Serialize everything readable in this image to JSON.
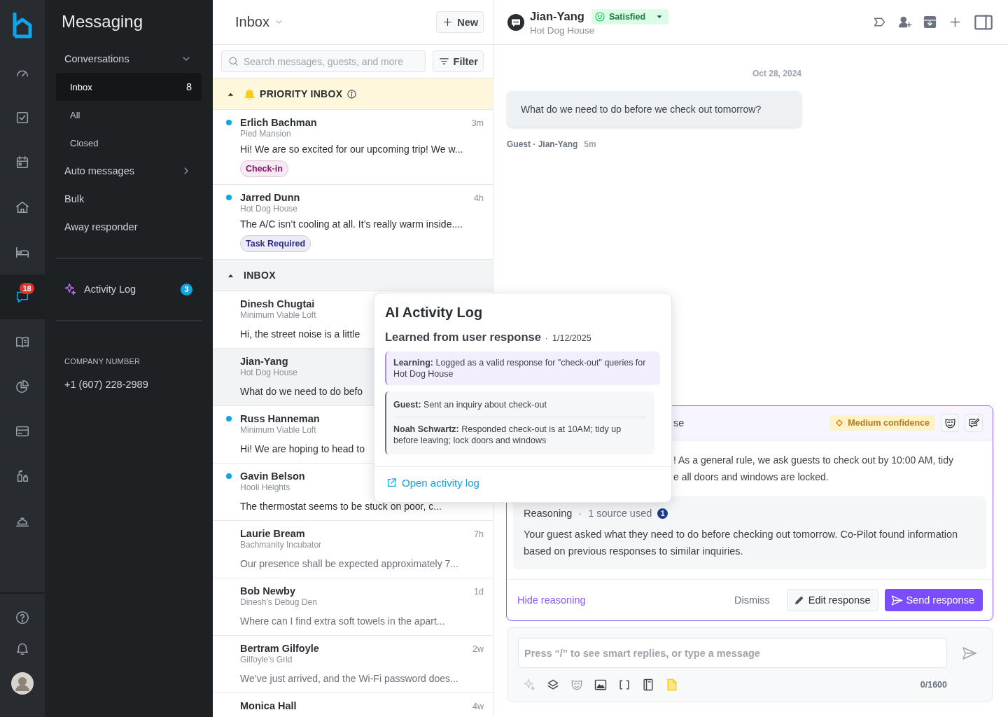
{
  "nav_rail": {
    "items": [
      {
        "selected": false
      },
      {
        "selected": false
      },
      {
        "selected": false
      },
      {
        "selected": false
      },
      {
        "selected": false
      },
      {
        "selected": true,
        "badge": "18"
      },
      {
        "selected": false
      },
      {
        "selected": false
      },
      {
        "selected": false
      },
      {
        "selected": false
      },
      {
        "selected": false
      }
    ]
  },
  "sidebar": {
    "title": "Messaging",
    "items": [
      {
        "kind": "group",
        "label": "Conversations",
        "expanded": true,
        "children": [
          {
            "label": "Inbox",
            "count": "8",
            "selected": true
          },
          {
            "label": "All",
            "selected": false
          },
          {
            "label": "Closed",
            "selected": false
          }
        ]
      },
      {
        "kind": "group",
        "label": "Auto messages",
        "expanded": false
      },
      {
        "kind": "link",
        "label": "Bulk"
      },
      {
        "kind": "link",
        "label": "Away responder"
      }
    ],
    "activity_log": {
      "label": "Activity Log",
      "badge": "3"
    },
    "company_number": {
      "label": "COMPANY NUMBER",
      "value": "+1 (607) 228-2989"
    }
  },
  "inbox": {
    "title": "Inbox",
    "new_button": "New",
    "search": {
      "placeholder": "Search messages, guests, and more"
    },
    "filter_button": "Filter",
    "sections": [
      {
        "kind": "priority",
        "title": "PRIORITY INBOX",
        "expanded": true,
        "rows": [
          {
            "name": "Erlich Bachman",
            "property": "Pied Mansion",
            "time": "3m",
            "preview": "Hi! We are so excited for our upcoming trip! We w...",
            "unread": true,
            "muted": false,
            "selected": false,
            "tag": {
              "label": "Check-in",
              "color": "#8a1466"
            }
          },
          {
            "name": "Jarred Dunn",
            "property": "Hot Dog House",
            "time": "4h",
            "preview": "The A/C isn’t cooling at all. It’s really warm inside....",
            "unread": true,
            "muted": false,
            "selected": false,
            "tag": {
              "label": "Task Required",
              "color": "#2e2a8c"
            }
          }
        ]
      },
      {
        "kind": "regular",
        "title": "INBOX",
        "expanded": true,
        "rows": [
          {
            "name": "Dinesh Chugtai",
            "property": "Minimum Viable Loft",
            "preview": "Hi, the street noise is a little",
            "unread": false,
            "muted": false,
            "selected": false
          },
          {
            "name": "Jian-Yang",
            "property": "Hot Dog House",
            "preview": "What do we need to do befo",
            "unread": false,
            "muted": false,
            "selected": true
          },
          {
            "name": "Russ Hanneman",
            "property": "Minimum Viable Loft",
            "preview": "Hi! We are hoping to head to",
            "unread": true,
            "muted": false,
            "selected": false
          },
          {
            "name": "Gavin Belson",
            "property": "Hooli Heights",
            "preview": "The thermostat seems to be stuck on poor, c...",
            "unread": true,
            "muted": false,
            "selected": false
          },
          {
            "name": "Laurie Bream",
            "property": "Bachmanity Incubator",
            "time": "7h",
            "preview": "Our presence shall be expected approximately 7...",
            "unread": false,
            "muted": true,
            "selected": false
          },
          {
            "name": "Bob Newby",
            "property": "Dinesh’s Debug Den",
            "time": "1d",
            "preview": "Where can I find extra soft towels in the apart...",
            "unread": false,
            "muted": true,
            "selected": false
          },
          {
            "name": "Bertram Gilfoyle",
            "property": "Gilfoyle’s Grid",
            "time": "2w",
            "preview": "We’ve just arrived, and the Wi-Fi password does...",
            "unread": false,
            "muted": true,
            "selected": false
          },
          {
            "name": "Monica Hall",
            "time": "4w",
            "unread": false,
            "selected": false
          }
        ]
      }
    ]
  },
  "conversation": {
    "header": {
      "name": "Jian-Yang",
      "property": "Hot Dog House",
      "sentiment": "Satisfied"
    },
    "date": "Oct 28, 2024",
    "messages": [
      {
        "text": "What do we need to do before we check out tomorrow?",
        "sender": "Guest · Jian-Yang",
        "time": "5m"
      }
    ],
    "suggestion": {
      "title": "se",
      "confidence": "Medium confidence",
      "response_lines": [
        "! As a general rule, we ask guests to check out by 10:00 AM, tidy",
        "e all doors and windows are locked."
      ],
      "reasoning": {
        "label": "Reasoning",
        "separator": "·",
        "sources": "1 source used",
        "source_count": "1",
        "text": "Your guest asked what they need to do before checking out tomorrow. Co-Pilot found information based on previous responses to similar inquiries."
      },
      "hide_reasoning": "Hide reasoning",
      "dismiss": "Dismiss",
      "edit_button": "Edit response",
      "send_button": "Send response"
    },
    "composer": {
      "placeholder": "Press “/” to see smart replies, or type a message",
      "counter": "0/1600"
    }
  },
  "activity_popover": {
    "title": "AI Activity Log",
    "event": "Learned from user response",
    "separator": "·",
    "date": "1/12/2025",
    "learning": "**Learning:** Logged as a valid response for \"check-out\" queries for Hot Dog House",
    "exchange": [
      "**Guest:** Sent an inquiry about check-out",
      "**Noah Schwartz:** Responded check-out is at 10AM; tidy up before leaving; lock doors and windows"
    ],
    "link": "Open activity log"
  }
}
